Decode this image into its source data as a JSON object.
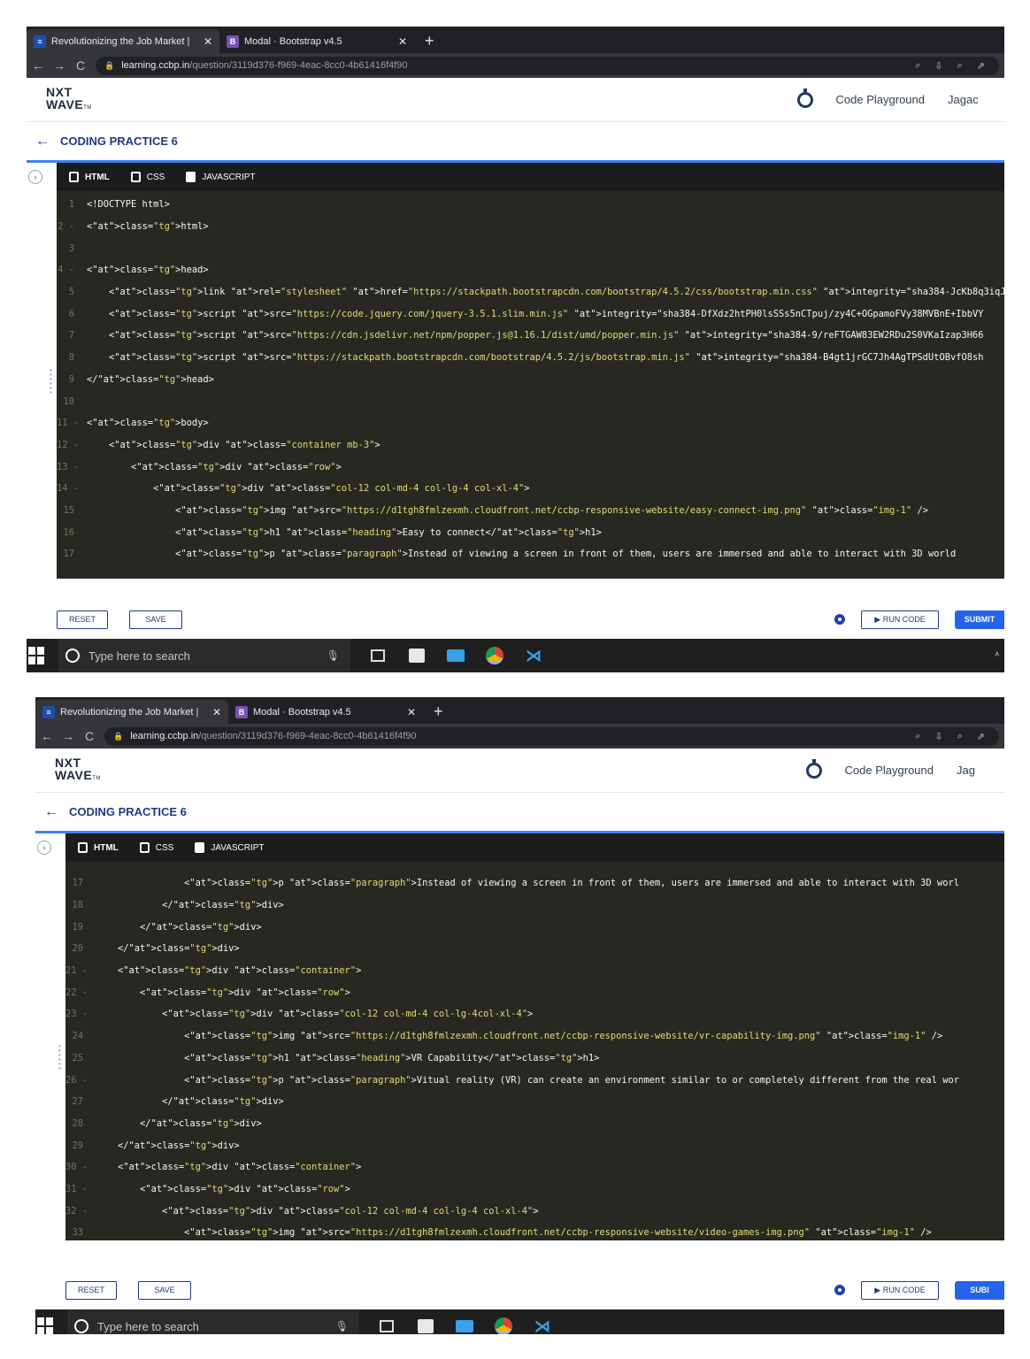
{
  "browser": {
    "tabs": [
      {
        "title": "Revolutionizing the Job Market |",
        "close": "✕"
      },
      {
        "title": "Modal · Bootstrap v4.5",
        "close": "✕"
      }
    ],
    "new_tab": "+",
    "url_host": "learning.ccbp.in",
    "url_path": "/question/3119d376-f969-4eac-8cc0-4b61416f4f90"
  },
  "app": {
    "logo_line1": "NXT",
    "logo_line2": "WAVE",
    "logo_tm": "TM",
    "code_playground": "Code Playground",
    "user_top": "Jagac",
    "user_bottom": "Jag",
    "page_title": "CODING PRACTICE 6"
  },
  "editor": {
    "tabs": [
      "HTML",
      "CSS",
      "JAVASCRIPT"
    ],
    "active_tab": "HTML",
    "top_lines": [
      {
        "n": "1",
        "code": "<!DOCTYPE html>"
      },
      {
        "n": "2 -",
        "code": "<html>"
      },
      {
        "n": "3",
        "code": ""
      },
      {
        "n": "4 -",
        "code": "<head>"
      },
      {
        "n": "5",
        "code": "    <link rel=\"stylesheet\" href=\"https://stackpath.bootstrapcdn.com/bootstrap/4.5.2/css/bootstrap.min.css\" integrity=\"sha384-JcKb8q3iqJ6"
      },
      {
        "n": "6",
        "code": "    <script src=\"https://code.jquery.com/jquery-3.5.1.slim.min.js\" integrity=\"sha384-DfXdz2htPH0lsSSs5nCTpuj/zy4C+OGpamoFVy38MVBnE+IbbVY"
      },
      {
        "n": "7",
        "code": "    <script src=\"https://cdn.jsdelivr.net/npm/popper.js@1.16.1/dist/umd/popper.min.js\" integrity=\"sha384-9/reFTGAW83EW2RDu2S0VKaIzap3H66"
      },
      {
        "n": "8",
        "code": "    <script src=\"https://stackpath.bootstrapcdn.com/bootstrap/4.5.2/js/bootstrap.min.js\" integrity=\"sha384-B4gt1jrGC7Jh4AgTPSdUtOBvfO8sh"
      },
      {
        "n": "9",
        "code": "</head>"
      },
      {
        "n": "10",
        "code": ""
      },
      {
        "n": "11 -",
        "code": "<body>"
      },
      {
        "n": "12 -",
        "code": "    <div class=\"container mb-3\">"
      },
      {
        "n": "13 -",
        "code": "        <div class=\"row\">"
      },
      {
        "n": "14 -",
        "code": "            <div class=\"col-12 col-md-4 col-lg-4 col-xl-4\">"
      },
      {
        "n": "15",
        "code": "                <img src=\"https://d1tgh8fmlzexmh.cloudfront.net/ccbp-responsive-website/easy-connect-img.png\" class=\"img-1\" />"
      },
      {
        "n": "16",
        "code": "                <h1 class=\"heading\">Easy to connect</h1>"
      },
      {
        "n": "17",
        "code": "                <p class=\"paragraph\">Instead of viewing a screen in front of them, users are immersed and able to interact with 3D world"
      }
    ],
    "bottom_lines": [
      {
        "n": "17",
        "code": "                <p class=\"paragraph\">Instead of viewing a screen in front of them, users are immersed and able to interact with 3D worl"
      },
      {
        "n": "18",
        "code": "            </div>"
      },
      {
        "n": "19",
        "code": "        </div>"
      },
      {
        "n": "20",
        "code": "    </div>"
      },
      {
        "n": "21 -",
        "code": "    <div class=\"container\">"
      },
      {
        "n": "22 -",
        "code": "        <div class=\"row\">"
      },
      {
        "n": "23 -",
        "code": "            <div class=\"col-12 col-md-4 col-lg-4col-xl-4\">"
      },
      {
        "n": "24",
        "code": "                <img src=\"https://d1tgh8fmlzexmh.cloudfront.net/ccbp-responsive-website/vr-capability-img.png\" class=\"img-1\" />"
      },
      {
        "n": "25",
        "code": "                <h1 class=\"heading\">VR Capability</h1>"
      },
      {
        "n": "26 -",
        "code": "                <p class=\"paragraph\">Vitual reality (VR) can create an environment similar to or completely different from the real wor"
      },
      {
        "n": "27",
        "code": "            </div>"
      },
      {
        "n": "28",
        "code": "        </div>"
      },
      {
        "n": "29",
        "code": "    </div>"
      },
      {
        "n": "30 -",
        "code": "    <div class=\"container\">"
      },
      {
        "n": "31 -",
        "code": "        <div class=\"row\">"
      },
      {
        "n": "32 -",
        "code": "            <div class=\"col-12 col-md-4 col-lg-4 col-xl-4\">"
      },
      {
        "n": "33",
        "code": "                <img src=\"https://d1tgh8fmlzexmh.cloudfront.net/ccbp-responsive-website/video-games-img.png\" class=\"img-1\" />"
      }
    ]
  },
  "footer": {
    "reset": "RESET",
    "save": "SAVE",
    "run": "▶ RUN CODE",
    "submit_top": "SUBMIT",
    "submit_bottom": "SUBI"
  },
  "taskbar": {
    "search_placeholder": "Type here to search"
  }
}
